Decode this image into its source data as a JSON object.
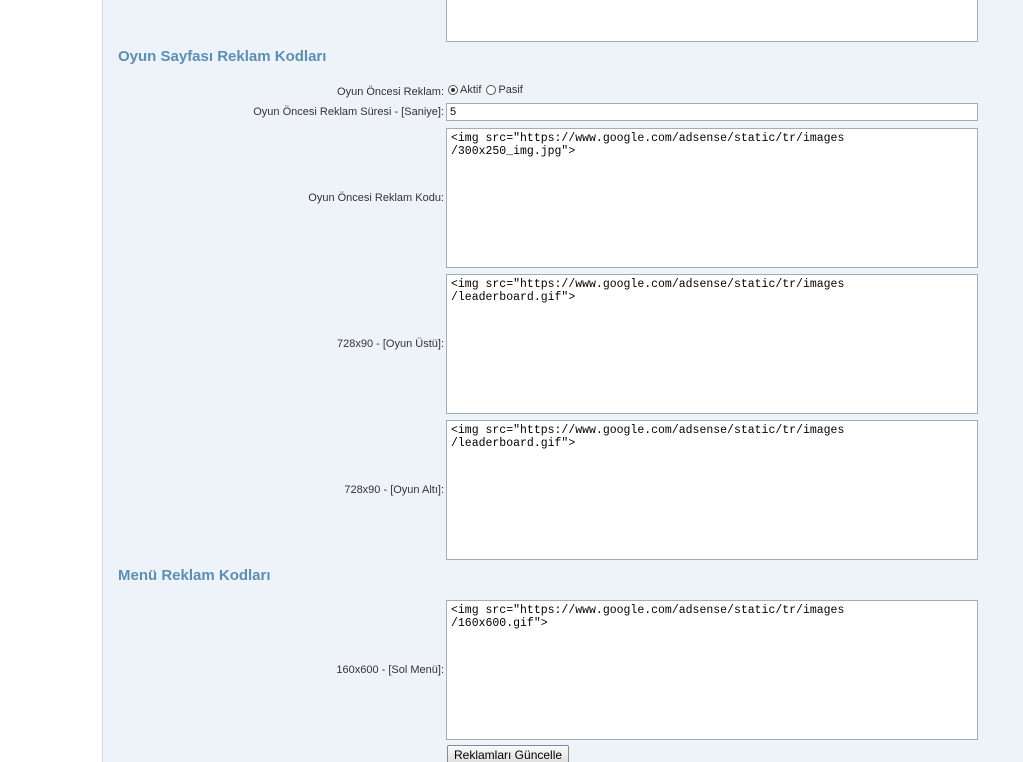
{
  "sections": {
    "game_page_title": "Oyun Sayfası Reklam Kodları",
    "menu_title": "Menü Reklam Kodları"
  },
  "pre_game_ad": {
    "label": "Oyun Öncesi Reklam:",
    "options": [
      "Aktif",
      "Pasif"
    ],
    "selected": "Aktif"
  },
  "pre_game_duration": {
    "label": "Oyun Öncesi Reklam Süresi - [Saniye]:",
    "value": "5"
  },
  "pre_game_code": {
    "label": "Oyun Öncesi Reklam Kodu:",
    "value": "<img src=\"https://www.google.com/adsense/static/tr/images\n/300x250_img.jpg\">"
  },
  "game_top": {
    "label": "728x90 - [Oyun Üstü]:",
    "value": "<img src=\"https://www.google.com/adsense/static/tr/images\n/leaderboard.gif\">"
  },
  "game_bottom": {
    "label": "728x90 - [Oyun Altı]:",
    "value": "<img src=\"https://www.google.com/adsense/static/tr/images\n/leaderboard.gif\">"
  },
  "left_menu": {
    "label": "160x600 - [Sol Menü]:",
    "value": "<img src=\"https://www.google.com/adsense/static/tr/images\n/160x600.gif\">"
  },
  "submit_label": "Reklamları Güncelle"
}
